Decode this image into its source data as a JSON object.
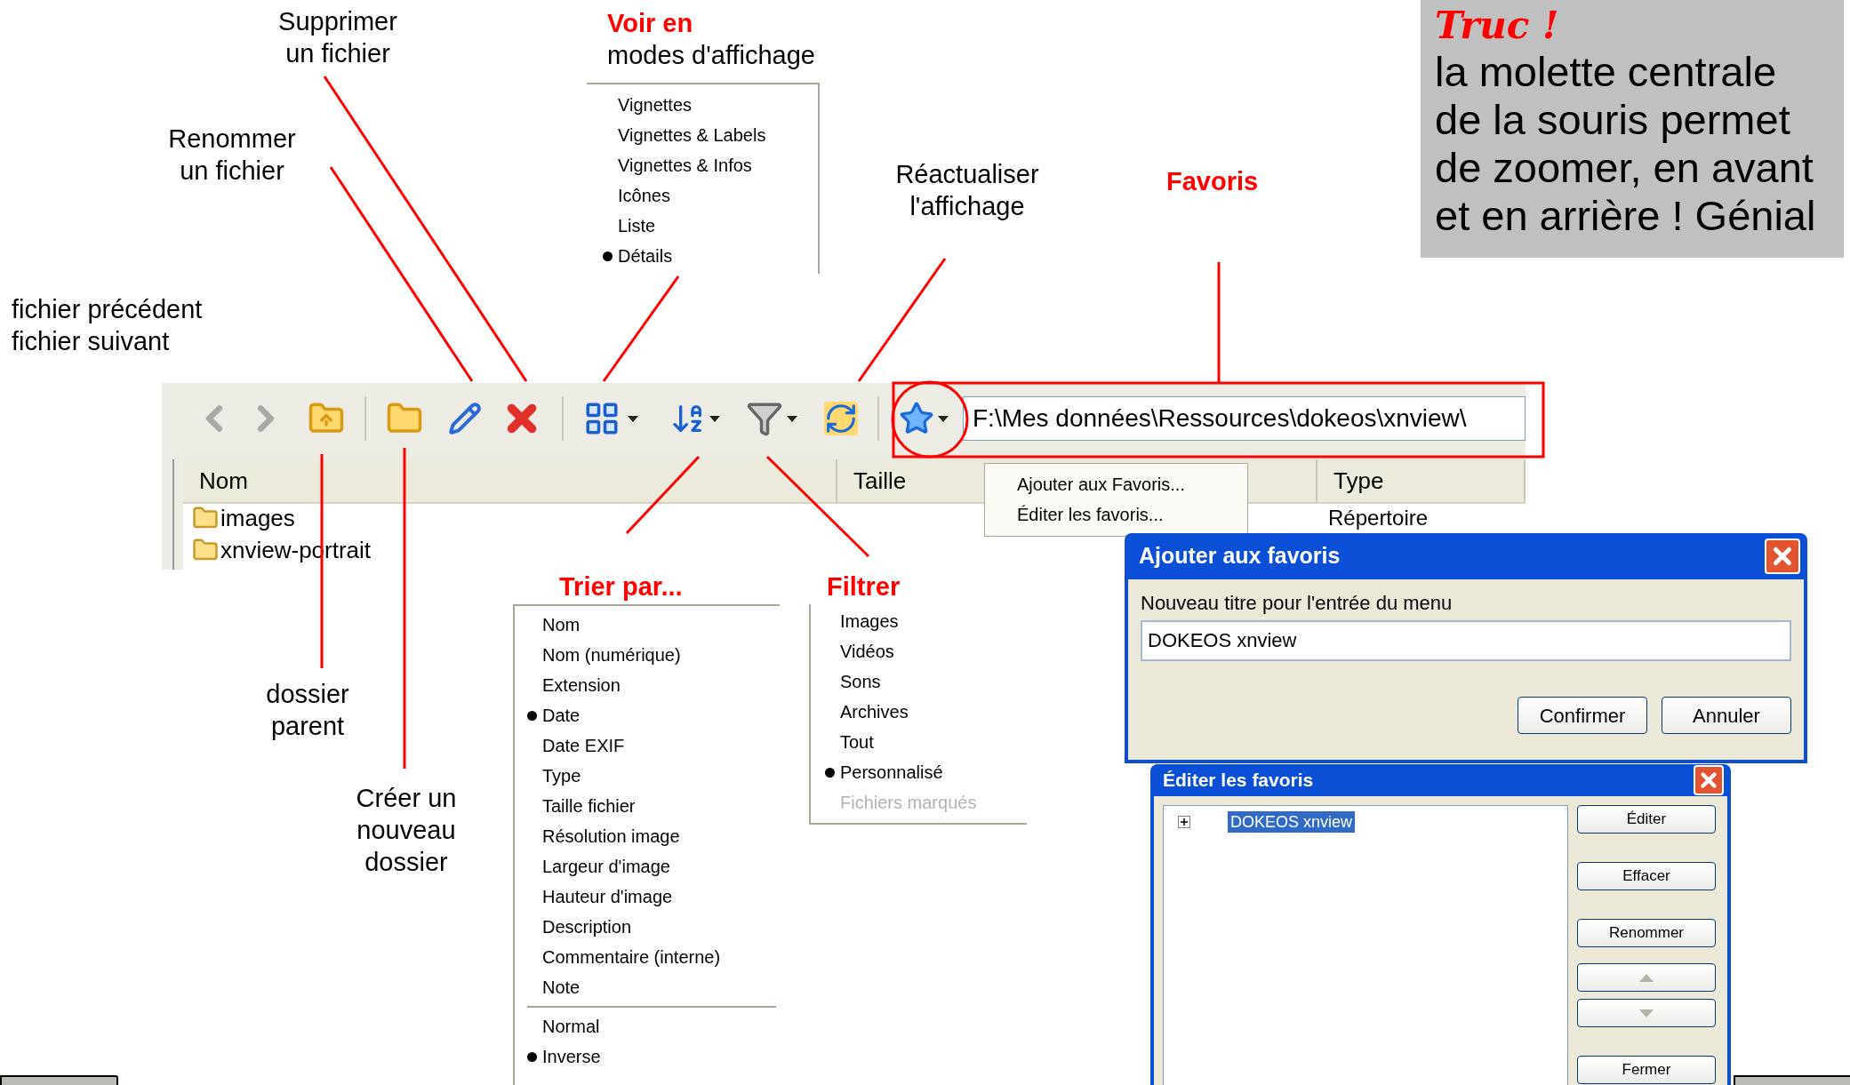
{
  "tip": {
    "title": "Truc !",
    "text": "la molette centrale de la souris permet de zoomer, en avant et en arrière ! Génial"
  },
  "callouts": [
    {
      "text": "Supprimer\nun fichier"
    },
    {
      "title": "Voir en",
      "text": "modes d'affichage"
    },
    {
      "text": "Renommer\nun fichier"
    },
    {
      "text": "Réactualiser\nl'affichage"
    },
    {
      "title": "Favoris"
    },
    {
      "text": "fichier précédent\nfichier suivant"
    },
    {
      "title": "Trier par..."
    },
    {
      "title": "Filtrer"
    },
    {
      "text": "dossier\nparent"
    },
    {
      "text": "Créer un\nnouveau\ndossier"
    }
  ],
  "view_menu": {
    "items": [
      {
        "label": "Vignettes",
        "selected": false
      },
      {
        "label": "Vignettes & Labels",
        "selected": false
      },
      {
        "label": "Vignettes & Infos",
        "selected": false
      },
      {
        "label": "Icônes",
        "selected": false
      },
      {
        "label": "Liste",
        "selected": false
      },
      {
        "label": "Détails",
        "selected": true
      }
    ]
  },
  "explorer": {
    "address": "F:\\Mes données\\Ressources\\dokeos\\xnview\\",
    "columns": [
      "Nom",
      "Taille",
      "Type"
    ],
    "rows": [
      {
        "name": "images",
        "type": "Répertoire"
      },
      {
        "name": "xnview-portrait"
      }
    ]
  },
  "favorites_menu": {
    "items": [
      "Ajouter aux Favoris...",
      "Éditer les favoris..."
    ]
  },
  "sort_menu": {
    "groups": [
      [
        {
          "label": "Nom",
          "selected": false
        },
        {
          "label": "Nom (numérique)",
          "selected": false
        },
        {
          "label": "Extension",
          "selected": false
        },
        {
          "label": "Date",
          "selected": true
        },
        {
          "label": "Date EXIF",
          "selected": false
        },
        {
          "label": "Type",
          "selected": false
        },
        {
          "label": "Taille fichier",
          "selected": false
        },
        {
          "label": "Résolution image",
          "selected": false
        },
        {
          "label": "Largeur d'image",
          "selected": false
        },
        {
          "label": "Hauteur d'image",
          "selected": false
        },
        {
          "label": "Description",
          "selected": false
        },
        {
          "label": "Commentaire (interne)",
          "selected": false
        },
        {
          "label": "Note",
          "selected": false
        }
      ],
      [
        {
          "label": "Normal",
          "selected": false
        },
        {
          "label": "Inverse",
          "selected": true
        }
      ]
    ]
  },
  "filter_menu": {
    "items": [
      {
        "label": "Images",
        "selected": false,
        "disabled": false
      },
      {
        "label": "Vidéos",
        "selected": false,
        "disabled": false
      },
      {
        "label": "Sons",
        "selected": false,
        "disabled": false
      },
      {
        "label": "Archives",
        "selected": false,
        "disabled": false
      },
      {
        "label": "Tout",
        "selected": false,
        "disabled": false
      },
      {
        "label": "Personnalisé",
        "selected": true,
        "disabled": false
      },
      {
        "label": "Fichiers marqués",
        "selected": false,
        "disabled": true
      }
    ]
  },
  "add_dialog": {
    "title": "Ajouter aux favoris",
    "label": "Nouveau titre pour l'entrée du menu",
    "value": "DOKEOS xnview",
    "buttons": [
      "Confirmer",
      "Annuler"
    ]
  },
  "edit_dialog": {
    "title": "Éditer les favoris",
    "tree": [
      {
        "label": "DOKEOS xnview",
        "selected": true,
        "expanded": false
      }
    ],
    "buttons": [
      {
        "kind": "text",
        "label": "Éditer",
        "disabled": false
      },
      {
        "kind": "text",
        "label": "Effacer",
        "disabled": false
      },
      {
        "kind": "text",
        "label": "Renommer",
        "disabled": false
      },
      {
        "kind": "up",
        "disabled": true
      },
      {
        "kind": "down",
        "disabled": true
      },
      {
        "kind": "text",
        "label": "Fermer",
        "disabled": false
      }
    ]
  }
}
